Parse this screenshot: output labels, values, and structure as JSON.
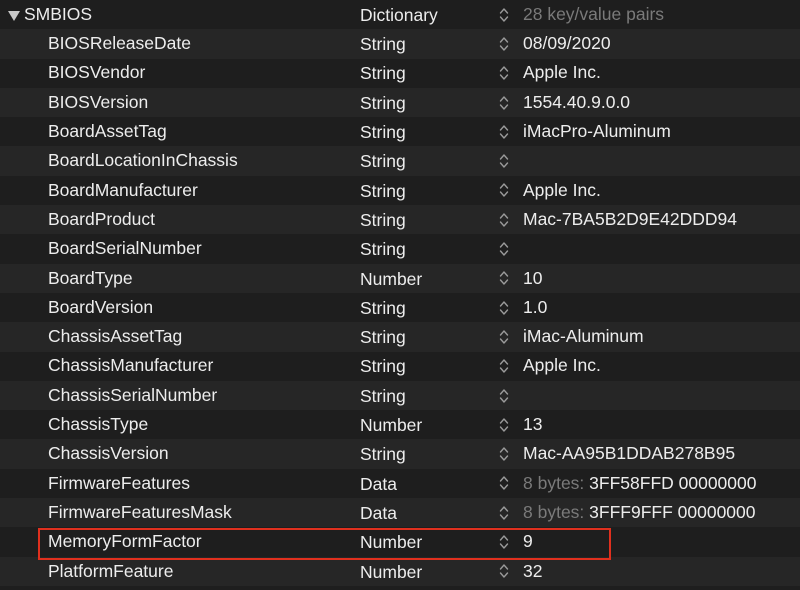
{
  "root": {
    "key": "SMBIOS",
    "type": "Dictionary",
    "value": "28 key/value pairs"
  },
  "rows": [
    {
      "key": "BIOSReleaseDate",
      "type": "String",
      "value": "08/09/2020"
    },
    {
      "key": "BIOSVendor",
      "type": "String",
      "value": "Apple Inc."
    },
    {
      "key": "BIOSVersion",
      "type": "String",
      "value": "1554.40.9.0.0"
    },
    {
      "key": "BoardAssetTag",
      "type": "String",
      "value": "iMacPro-Aluminum"
    },
    {
      "key": "BoardLocationInChassis",
      "type": "String",
      "value": ""
    },
    {
      "key": "BoardManufacturer",
      "type": "String",
      "value": "Apple Inc."
    },
    {
      "key": "BoardProduct",
      "type": "String",
      "value": "Mac-7BA5B2D9E42DDD94"
    },
    {
      "key": "BoardSerialNumber",
      "type": "String",
      "value": ""
    },
    {
      "key": "BoardType",
      "type": "Number",
      "value": "10"
    },
    {
      "key": "BoardVersion",
      "type": "String",
      "value": "1.0"
    },
    {
      "key": "ChassisAssetTag",
      "type": "String",
      "value": "iMac-Aluminum"
    },
    {
      "key": "ChassisManufacturer",
      "type": "String",
      "value": "Apple Inc."
    },
    {
      "key": "ChassisSerialNumber",
      "type": "String",
      "value": ""
    },
    {
      "key": "ChassisType",
      "type": "Number",
      "value": "13"
    },
    {
      "key": "ChassisVersion",
      "type": "String",
      "value": "Mac-AA95B1DDAB278B95"
    },
    {
      "key": "FirmwareFeatures",
      "type": "Data",
      "value_prefix": "8 bytes:",
      "value": "3FF58FFD 00000000"
    },
    {
      "key": "FirmwareFeaturesMask",
      "type": "Data",
      "value_prefix": "8 bytes:",
      "value": "3FFF9FFF 00000000"
    },
    {
      "key": "MemoryFormFactor",
      "type": "Number",
      "value": "9",
      "highlighted": true
    },
    {
      "key": "PlatformFeature",
      "type": "Number",
      "value": "32"
    }
  ],
  "colors": {
    "background": "#1e1e1e",
    "alt_row": "#262626",
    "text": "#ededed",
    "dim_text": "#7a7a7a",
    "highlight_border": "#e0301e"
  },
  "icons": {
    "disclosure": "disclosure-triangle-expanded-icon",
    "stepper": "up-down-stepper-icon"
  }
}
